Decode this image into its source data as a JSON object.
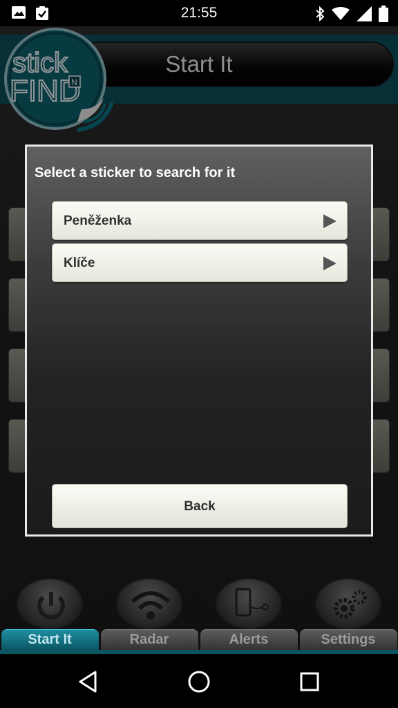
{
  "status_bar": {
    "time": "21:55",
    "left_icons": [
      "image-icon",
      "clipboard-check-icon"
    ],
    "right_icons": [
      "bluetooth-icon",
      "wifi-icon",
      "signal-icon",
      "battery-icon"
    ]
  },
  "header": {
    "logo_text": "stick N FIND",
    "title": "Start It"
  },
  "dialog": {
    "title": "Select a sticker to search for it",
    "options": [
      {
        "label": "Peněženka",
        "icon": "play-arrow-icon"
      },
      {
        "label": "Klíče",
        "icon": "play-arrow-icon"
      }
    ],
    "back_label": "Back"
  },
  "tabs": [
    {
      "label": "Start It",
      "icon": "power-icon",
      "active": true
    },
    {
      "label": "Radar",
      "icon": "wifi-icon",
      "active": false
    },
    {
      "label": "Alerts",
      "icon": "phone-alert-icon",
      "active": false
    },
    {
      "label": "Settings",
      "icon": "gears-icon",
      "active": false
    }
  ],
  "nav": [
    "back-triangle-icon",
    "home-circle-icon",
    "recents-square-icon"
  ],
  "colors": {
    "accent_teal": "#0b5563",
    "button_cream": "#f1f0e7",
    "dialog_border": "#e9e9e9"
  }
}
